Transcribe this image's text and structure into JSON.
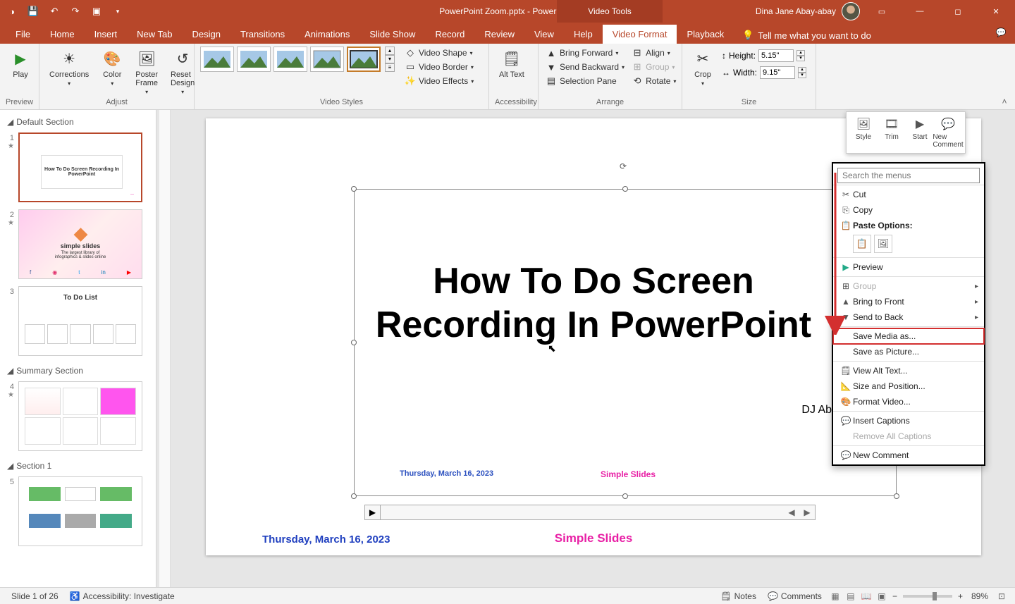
{
  "titlebar": {
    "document_title": "PowerPoint Zoom.pptx  -  PowerPoint",
    "context_tab": "Video Tools",
    "user_name": "Dina Jane Abay-abay"
  },
  "tabs": {
    "items": [
      "File",
      "Home",
      "Insert",
      "New Tab",
      "Design",
      "Transitions",
      "Animations",
      "Slide Show",
      "Record",
      "Review",
      "View",
      "Help",
      "Video Format",
      "Playback"
    ],
    "active": "Video Format",
    "tell_me": "Tell me what you want to do"
  },
  "ribbon": {
    "preview": {
      "play": "Play",
      "label": "Preview"
    },
    "adjust": {
      "corrections": "Corrections",
      "color": "Color",
      "poster": "Poster Frame",
      "reset": "Reset Design",
      "label": "Adjust"
    },
    "video_styles": {
      "shape": "Video Shape",
      "border": "Video Border",
      "effects": "Video Effects",
      "label": "Video Styles"
    },
    "accessibility": {
      "alt": "Alt Text",
      "label": "Accessibility"
    },
    "arrange": {
      "bring": "Bring Forward",
      "send": "Send Backward",
      "selection": "Selection Pane",
      "align": "Align",
      "group": "Group",
      "rotate": "Rotate",
      "label": "Arrange"
    },
    "size": {
      "crop": "Crop",
      "height_label": "Height:",
      "height_val": "5.15\"",
      "width_label": "Width:",
      "width_val": "9.15\"",
      "label": "Size"
    }
  },
  "sections": {
    "default": "Default Section",
    "summary": "Summary Section",
    "section1": "Section 1",
    "slides": {
      "n1": "1",
      "n2": "2",
      "n3": "3",
      "n4": "4",
      "n5": "5"
    }
  },
  "slide": {
    "title": "How To Do Screen Recording In PowerPoint",
    "author": "DJ Abay-abay",
    "date_inner": "Thursday, March 16, 2023",
    "brand_inner": "Simple Slides",
    "date_outer": "Thursday, March 16, 2023",
    "brand_outer": "Simple Slides"
  },
  "mini_toolbar": {
    "style": "Style",
    "trim": "Trim",
    "start": "Start",
    "comment": "New Comment"
  },
  "context_menu": {
    "search_placeholder": "Search the menus",
    "cut": "Cut",
    "copy": "Copy",
    "paste_options": "Paste Options:",
    "preview": "Preview",
    "group": "Group",
    "bring_front": "Bring to Front",
    "send_back": "Send to Back",
    "save_media": "Save Media as...",
    "save_picture": "Save as Picture...",
    "view_alt": "View Alt Text...",
    "size_pos": "Size and Position...",
    "format_video": "Format Video...",
    "insert_cap": "Insert Captions",
    "remove_cap": "Remove All Captions",
    "new_comment": "New Comment"
  },
  "statusbar": {
    "slide_count": "Slide 1 of 26",
    "accessibility": "Accessibility: Investigate",
    "notes": "Notes",
    "comments": "Comments",
    "zoom": "89%"
  },
  "thumbs": {
    "t1_title": "How To Do Screen Recording In PowerPoint",
    "t2_brand": "simple slides",
    "t2_tag": "The largest library of infographics & slides online",
    "t3_title": "To Do List"
  }
}
